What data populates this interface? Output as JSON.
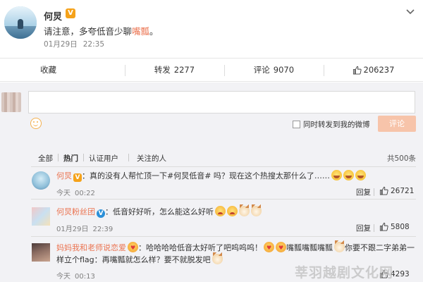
{
  "post": {
    "author": "何炅",
    "badge": "V",
    "text_before": "请注意，多夸低音少聊",
    "text_highlight": "嘴瓢",
    "text_after": "。",
    "date": "01月29日",
    "time": "22:35"
  },
  "actions": {
    "favorite_label": "收藏",
    "repost_label": "转发",
    "repost_count": "2277",
    "comment_label": "评论",
    "comment_count": "9070",
    "like_count": "206237"
  },
  "composer": {
    "input_value": "",
    "repost_checkbox_label": "同时转发到我的微博",
    "submit_label": "评论"
  },
  "filters": {
    "all": "全部",
    "hot": "热门",
    "verified": "认证用户",
    "following": "关注的人",
    "total": "共500条"
  },
  "comments": [
    {
      "name": "何炅",
      "badge": "V",
      "text": "：真的没有人帮忙顶一下#何炅低音# 吗？现在这个热搜太那什么了……",
      "time_day": "今天",
      "time": "00:22",
      "reply_label": "回复",
      "likes": "26721",
      "emojis": [
        "laugh",
        "laugh",
        "laugh"
      ]
    },
    {
      "name": "何炅粉丝团",
      "badge": "V",
      "text": "：低音好好听，怎么能这么好听",
      "time_day": "01月29日",
      "time": "22:39",
      "reply_label": "回复",
      "likes": "5808",
      "emojis": [
        "cry",
        "cry",
        "cat",
        "cat"
      ]
    },
    {
      "name": "妈妈我和老师说恋爱",
      "text_a": "：哈哈哈哈低音太好听了吧呜呜呜！",
      "text_b": "嘴瓢嘴瓢嘴瓢",
      "text_c": "你要不跟二字弟弟一",
      "text_line2": "样立个flag：再嘴瓢就怎么样？要不就脱发吧",
      "time_day": "今天",
      "time": "00:13",
      "likes": "4293"
    }
  ],
  "watermark": "莘羽越剧文化网",
  "colors": {
    "accent": "#eb7350",
    "vip_badge": "#f5a21a",
    "blue_badge": "#2b8fd8",
    "background_comments": "#f2f2f5"
  }
}
